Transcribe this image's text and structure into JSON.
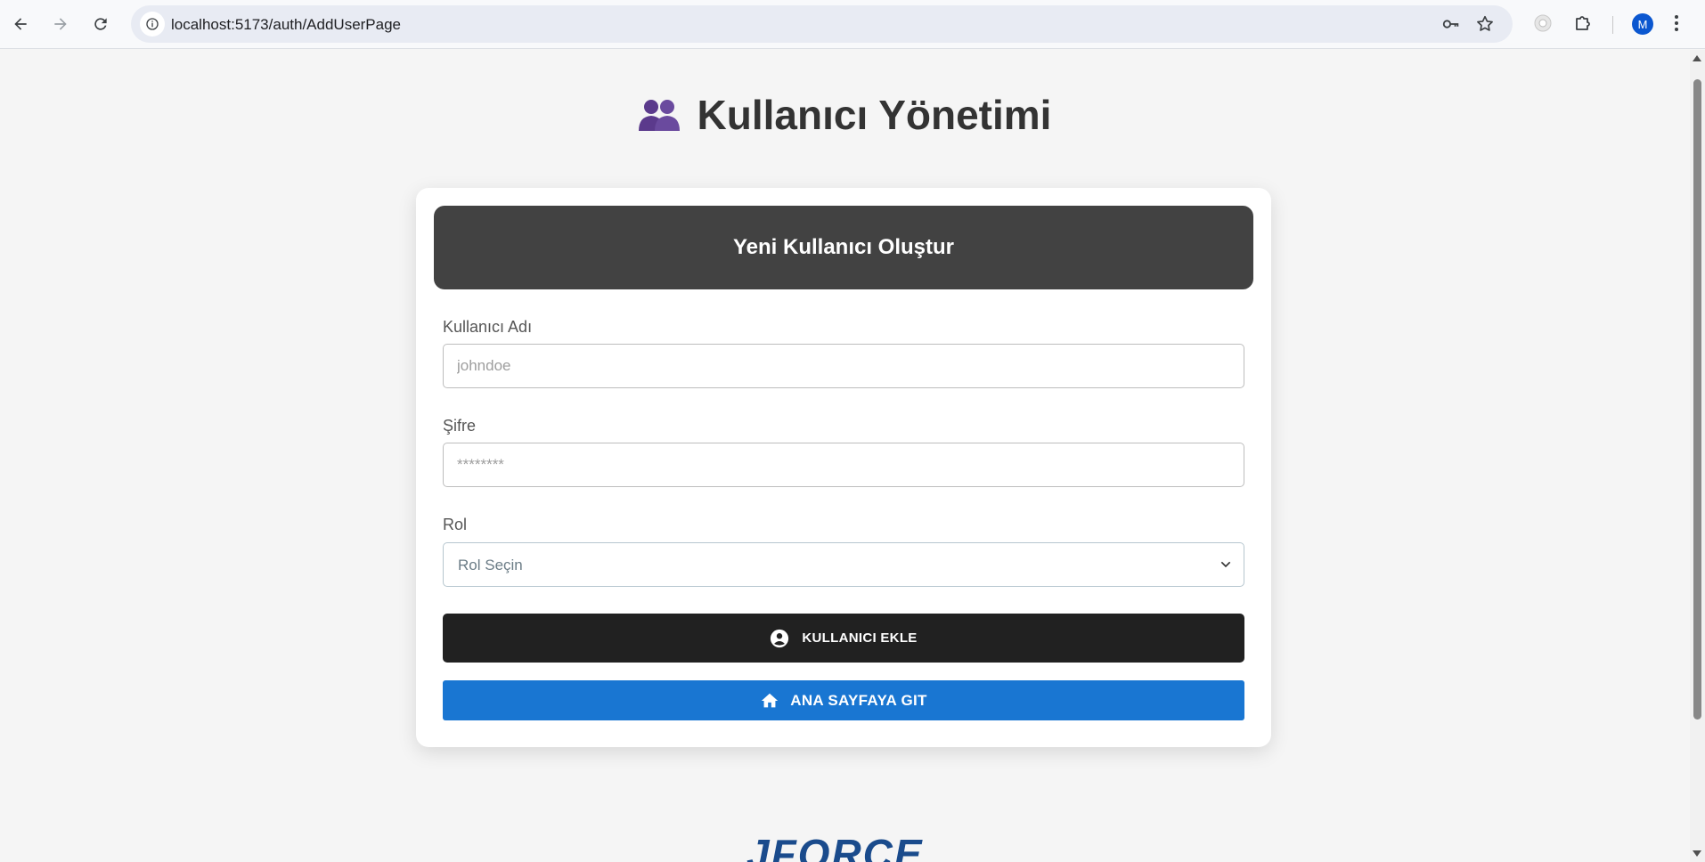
{
  "browser": {
    "url": "localhost:5173/auth/AddUserPage",
    "profile_initial": "M"
  },
  "page": {
    "title": "Kullanıcı Yönetimi",
    "title_icon": "people-icon"
  },
  "form": {
    "header": "Yeni Kullanıcı Oluştur",
    "username_label": "Kullanıcı Adı",
    "username_placeholder": "johndoe",
    "password_label": "Şifre",
    "password_placeholder": "********",
    "role_label": "Rol",
    "role_selected": "Rol Seçin",
    "add_button": "KULLANICI EKLE",
    "home_button": "ANA SAYFAYA GIT"
  },
  "footer": {
    "logo_text": "JFORCE"
  },
  "colors": {
    "header_bg": "#424242",
    "add_button_bg": "#212121",
    "home_button_bg": "#1976d2",
    "title_icon": "#5b3a8c"
  }
}
